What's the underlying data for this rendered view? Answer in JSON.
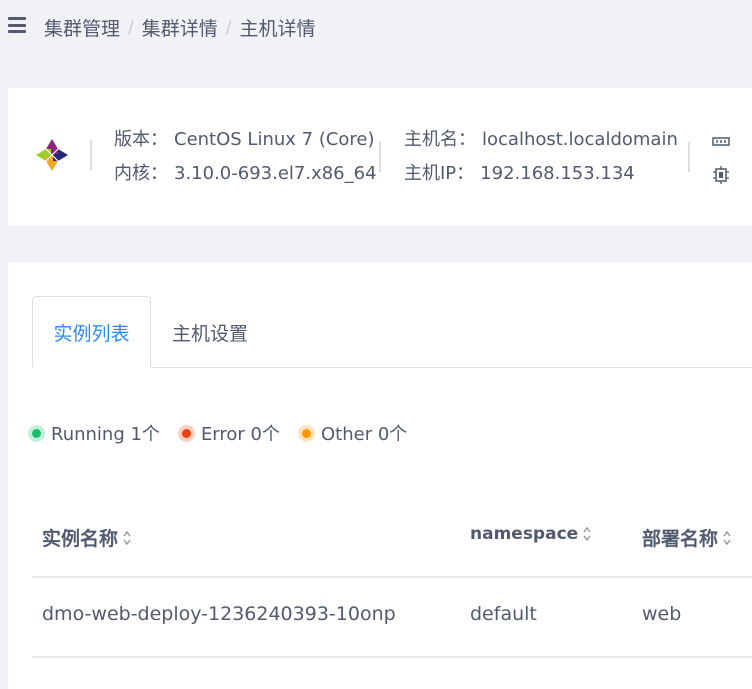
{
  "breadcrumb": {
    "items": [
      "集群管理",
      "集群详情",
      "主机详情"
    ],
    "separator": "/"
  },
  "host_info": {
    "version_label": "版本：",
    "version_value": "CentOS Linux 7 (Core)",
    "kernel_label": "内核：",
    "kernel_value": "3.10.0-693.el7.x86_64",
    "hostname_label": "主机名：",
    "hostname_value": "localhost.localdomain",
    "hostip_label": "主机IP：",
    "hostip_value": "192.168.153.134"
  },
  "tabs": [
    {
      "label": "实例列表",
      "active": true
    },
    {
      "label": "主机设置",
      "active": false
    }
  ],
  "status": [
    {
      "label": "Running 1个",
      "color": "#19be6b"
    },
    {
      "label": "Error 0个",
      "color": "#ed4014"
    },
    {
      "label": "Other 0个",
      "color": "#ff9900"
    }
  ],
  "table": {
    "columns": [
      "实例名称",
      "namespace",
      "部署名称"
    ],
    "rows": [
      [
        "dmo-web-deploy-1236240393-10onp",
        "default",
        "web"
      ]
    ]
  },
  "colors": {
    "accent": "#2d8cf0",
    "text": "#515a6e",
    "background": "#f0f2f5"
  }
}
